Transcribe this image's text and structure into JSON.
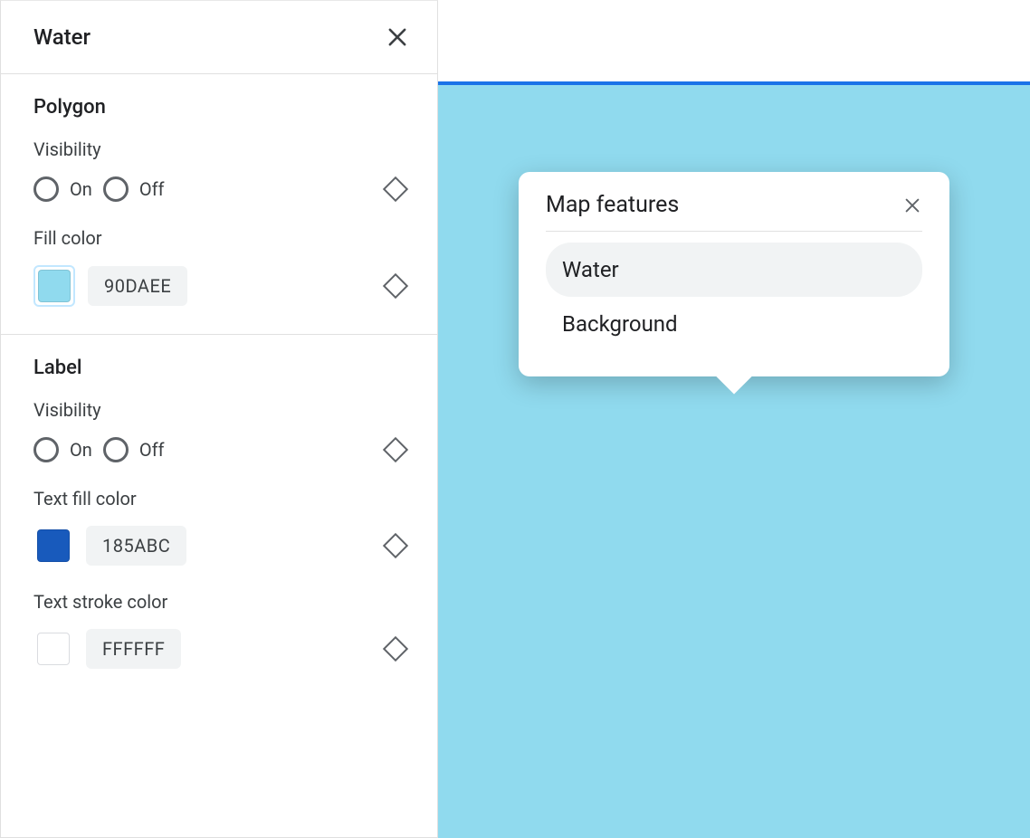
{
  "sidebar": {
    "title": "Water",
    "sections": {
      "polygon": {
        "title": "Polygon",
        "visibility_label": "Visibility",
        "on_label": "On",
        "off_label": "Off",
        "fill_color_label": "Fill color",
        "fill_color_hex": "90DAEE",
        "fill_color_value": "#90DAEE"
      },
      "label": {
        "title": "Label",
        "visibility_label": "Visibility",
        "on_label": "On",
        "off_label": "Off",
        "text_fill_label": "Text fill color",
        "text_fill_hex": "185ABC",
        "text_fill_value": "#185ABC",
        "text_stroke_label": "Text stroke color",
        "text_stroke_hex": "FFFFFF",
        "text_stroke_value": "#FFFFFF"
      }
    }
  },
  "preview": {
    "map_color": "#90DAEE",
    "accent_color": "#1a73e8"
  },
  "popover": {
    "title": "Map features",
    "items": [
      {
        "label": "Water",
        "selected": true
      },
      {
        "label": "Background",
        "selected": false
      }
    ]
  }
}
